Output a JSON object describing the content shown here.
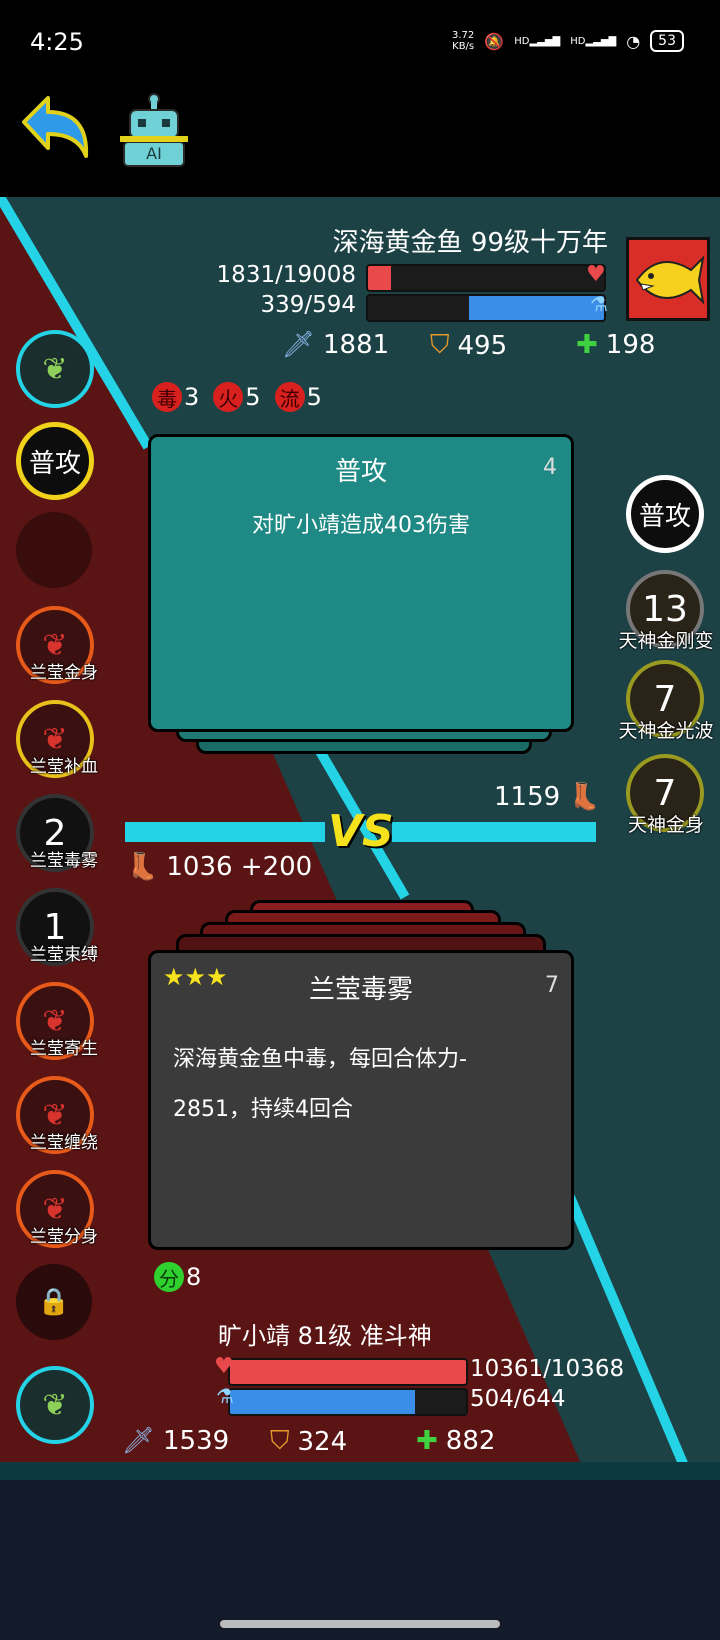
{
  "status_bar": {
    "time": "4:25",
    "net_speed_top": "3.72",
    "net_speed_bottom": "KB/s",
    "signal_1": "HD",
    "signal_2": "HD",
    "battery": "53"
  },
  "header": {
    "back_icon": "back-arrow-icon",
    "ai_icon": "robot-icon",
    "ai_label": "AI"
  },
  "enemy": {
    "name": "深海黄金鱼 99级十万年",
    "hp_text": "1831/19008",
    "hp_fraction": 0.096,
    "mp_text": "339/594",
    "mp_fraction": 0.571,
    "attack": "1881",
    "defense": "495",
    "heal": "198",
    "effects": [
      {
        "icon": "毒",
        "value": "3"
      },
      {
        "icon": "火",
        "value": "5"
      },
      {
        "icon": "流",
        "value": "5"
      }
    ],
    "skills": [
      {
        "label": "普攻",
        "num": ""
      },
      {
        "label": "天神金刚变",
        "num": "13"
      },
      {
        "label": "天神金光波",
        "num": "7"
      },
      {
        "label": "天神金身",
        "num": "7"
      }
    ],
    "speed": "1159"
  },
  "enemy_card": {
    "title": "普攻",
    "count": "4",
    "text": "对旷小靖造成403伤害"
  },
  "vs_label": "VS",
  "player": {
    "name": "旷小靖 81级 准斗神",
    "hp_text": "10361/10368",
    "hp_fraction": 0.999,
    "mp_text": "504/644",
    "mp_fraction": 0.783,
    "attack": "1539",
    "defense": "324",
    "heal": "882",
    "speed": "1036 +200",
    "score_icon": "分",
    "score": "8",
    "skills": [
      {
        "label": "普攻",
        "num": ""
      },
      {
        "label": "兰莹金身",
        "num": ""
      },
      {
        "label": "兰莹补血",
        "num": ""
      },
      {
        "label": "兰莹毒雾",
        "num": "2"
      },
      {
        "label": "兰莹束缚",
        "num": "1"
      },
      {
        "label": "兰莹寄生",
        "num": ""
      },
      {
        "label": "兰莹缠绕",
        "num": ""
      },
      {
        "label": "兰莹分身",
        "num": ""
      }
    ]
  },
  "player_card": {
    "stars": "★★★",
    "title": "兰莹毒雾",
    "count": "7",
    "text_line1": "深海黄金鱼中毒，每回合体力-",
    "text_line2": "2851，持续4回合"
  },
  "colors": {
    "teal_bg": "#1d4246",
    "red_bg": "#5a1414",
    "cyan_accent": "#24d3e6",
    "hp_red": "#e8494b",
    "mp_blue": "#3b8ee8",
    "card_teal": "#1f8a85",
    "card_dark": "#3b3b3b"
  }
}
